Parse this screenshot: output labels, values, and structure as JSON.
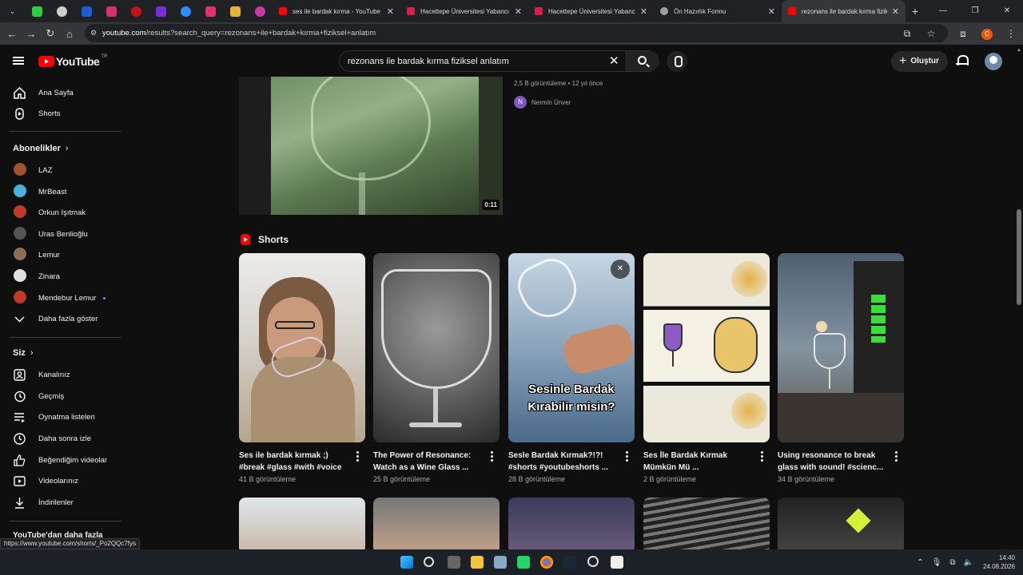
{
  "browser": {
    "tabs": [
      {
        "title": "ses ile bardak kırma - YouTube",
        "color": "#ff0000"
      },
      {
        "title": "Hacettepe Üniversitesi Yabancı",
        "color": "#d6204b"
      },
      {
        "title": "Hacettepe Üniversitesi Yabancı",
        "color": "#d6204b"
      },
      {
        "title": "Ön Hazırlık Formu",
        "color": "#9aa0a6"
      },
      {
        "title": "rezonans ile bardak kırma fiziks",
        "color": "#ff0000",
        "active": true
      }
    ],
    "pinned_icons": [
      "k-icon",
      "shield-icon",
      "x-icon",
      "w-icon",
      "red-circle-icon",
      "play-icon",
      "zoom-icon",
      "instagram-icon",
      "puzzle-icon",
      "firefox-icon"
    ],
    "url_domain": "youtube.com",
    "url_path": "/results?search_query=rezonans+ile+bardak+kırma+fiziksel+anlatım",
    "new_tab": "+",
    "profile_initial": "C"
  },
  "header": {
    "logo_text": "YouTube",
    "logo_region": "TR",
    "search_value": "rezonans ile bardak kırma fiziksel anlatım",
    "create_label": "Oluştur"
  },
  "sidebar": {
    "main": [
      {
        "label": "Ana Sayfa",
        "icon": "home-icon"
      },
      {
        "label": "Shorts",
        "icon": "shorts-icon"
      }
    ],
    "subs_title": "Abonelikler",
    "subs": [
      {
        "label": "LAZ",
        "color": "#a0522d"
      },
      {
        "label": "MrBeast",
        "color": "#4ab0e0"
      },
      {
        "label": "Orkun Işıtmak",
        "color": "#c0392b"
      },
      {
        "label": "Uras Benlioğlu",
        "color": "#555555"
      },
      {
        "label": "Lemur",
        "color": "#8e6e53"
      },
      {
        "label": "Zinara",
        "color": "#e0e0e0"
      },
      {
        "label": "Mendebur Lemur",
        "color": "#c0392b"
      }
    ],
    "show_more": "Daha fazla göster",
    "you_title": "Siz",
    "you": [
      {
        "label": "Kanalınız",
        "icon": "channel-icon"
      },
      {
        "label": "Geçmiş",
        "icon": "history-icon"
      },
      {
        "label": "Oynatma listeleri",
        "icon": "playlist-icon"
      },
      {
        "label": "Daha sonra izle",
        "icon": "clock-icon"
      },
      {
        "label": "Beğendiğim videolar",
        "icon": "like-icon"
      },
      {
        "label": "Videolarınız",
        "icon": "video-icon"
      },
      {
        "label": "İndirilenler",
        "icon": "download-icon"
      }
    ],
    "explore_title": "YouTube'dan daha fazla"
  },
  "video": {
    "duration": "0:11",
    "meta": "2,5 B görüntüleme • 12 yıl önce",
    "channel": "Nermin Ünver",
    "channel_initial": "N"
  },
  "shorts": {
    "title": "Shorts",
    "items": [
      {
        "title": "Ses ile bardak kırmak ;) #break #glass #with #voice",
        "views": "41 B görüntüleme"
      },
      {
        "title": "The Power of Resonance: Watch as a Wine Glass ...",
        "views": "25 B görüntüleme"
      },
      {
        "title": "Sesle Bardak Kırmak?!?! #shorts #youtubeshorts ...",
        "views": "28 B görüntüleme",
        "overlay": "Sesinle Bardak Kırabilir misin?"
      },
      {
        "title": "Ses İle Bardak Kırmak Mümkün Mü ...",
        "views": "2 B görüntüleme"
      },
      {
        "title": "Using resonance to break glass with sound! #scienc...",
        "views": "34 B görüntüleme"
      }
    ]
  },
  "status_url": "https://www.youtube.com/shorts/_Po2QQc7fys",
  "clock": {
    "time": "14:40",
    "date": "24.08.2026"
  }
}
